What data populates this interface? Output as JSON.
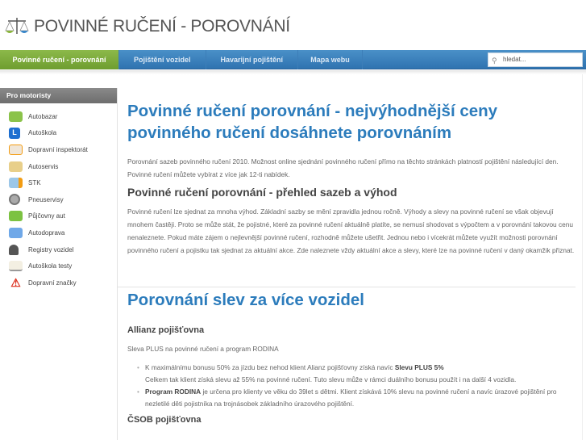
{
  "site": {
    "title": "POVINNÉ RUČENÍ - POROVNÁNÍ"
  },
  "nav": {
    "items": [
      "Povinné ručení - porovnání",
      "Pojištění vozidel",
      "Havarijní pojištění",
      "Mapa webu"
    ],
    "search_placeholder": "hledat..."
  },
  "sidebar": {
    "title": "Pro motoristy",
    "items": [
      "Autobazar",
      "Autoškola",
      "Dopravní inspektorát",
      "Autoservis",
      "STK",
      "Pneuservisy",
      "Půjčovny aut",
      "Autodoprava",
      "Registry vozidel",
      "Autoškola testy",
      "Dopravní značky"
    ]
  },
  "main": {
    "h1": "Povinné ručení porovnání - nejvýhodnější ceny povinného ručení dosáhnete porovnáním",
    "intro": "Porovnání sazeb povinného ručení 2010. Možnost online sjednání povinného ručení přímo na těchto stránkách platností pojištění následující den. Povinné ručení můžete vybírat z více jak 12-ti nabídek.",
    "h2": "Povinné ručení porovnání - přehled sazeb a výhod",
    "p2": "Povinné ručení lze sjednat za mnoha výhod. Základní sazby se mění zpravidla jednou ročně. Výhody a slevy na povinné ručení se však objevují mnohem častěji. Proto se může stát, že pojistné, které za povinné ručení aktuálně platíte, se nemusí shodovat s výpočtem a v porovnání takovou cenu nenaleznete. Pokud máte zájem o nejlevnější povinné ručení, rozhodně můžete ušetřit. Jednou nebo i vícekrát můžete využít možnosti porovnání povinného ručení a pojistku tak sjednat za aktuální akce. Zde naleznete vždy aktuální akce a slevy, které lze na povinné ručení v daný okamžik přiznat.",
    "h1b": "Porovnání slev za více vozidel",
    "allianz": {
      "title": "Allianz pojišťovna",
      "sub": "Sleva PLUS na povinné ručení a program RODINA",
      "b1_text": "K maximálnímu bonusu 50% za jízdu bez nehod klient Alianz pojišťovny získá navíc ",
      "b1_bold": "Slevu PLUS 5%",
      "b1_text2": "Celkem tak klient získá slevu až 55% na povinné ručení. Tuto slevu může v rámci duálního bonusu použít i na další 4 vozidla.",
      "b2_bold": "Program RODINA",
      "b2_text": " je určena pro klienty ve věku do 39let s dětmi. Klient získává 10% slevu na povinné ručení a navíc úrazové pojištění pro nezletilé děti pojistníka na trojnásobek základního úrazového pojištění."
    },
    "csob": {
      "title": "ČSOB pojišťovna"
    }
  }
}
